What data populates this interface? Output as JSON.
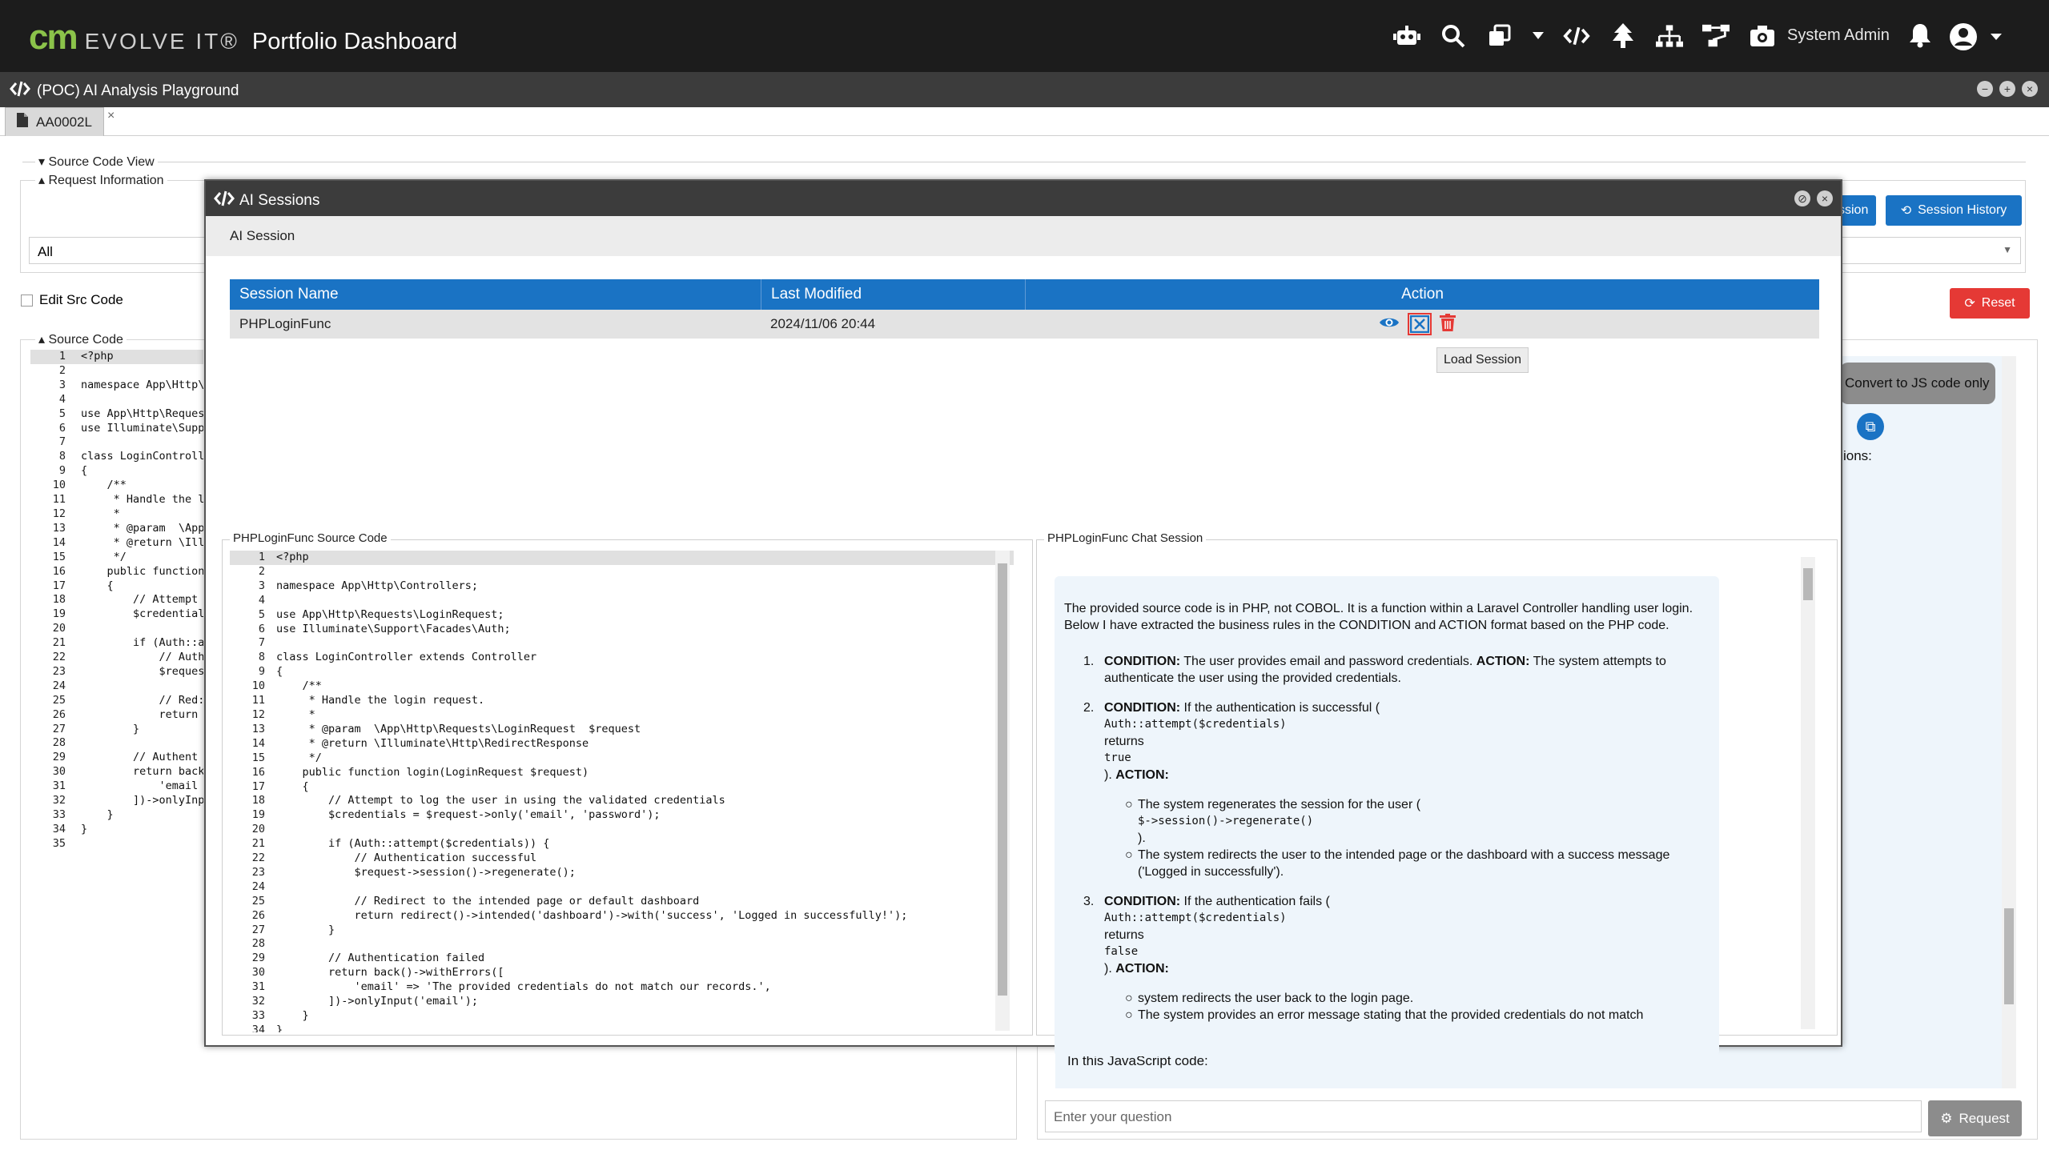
{
  "topbar": {
    "logo_cm": "CM",
    "logo_evolve": "EVOLVE IT®",
    "title": "Portfolio Dashboard",
    "user": "System Admin",
    "icons": [
      "robot-icon",
      "search-icon",
      "copy-icon",
      "caret-down-icon",
      "code-icon",
      "tree-icon",
      "hierarchy-icon",
      "flow-icon",
      "camera-icon",
      "bell-icon",
      "user-avatar-icon"
    ]
  },
  "window": {
    "title": "(POC) AI Analysis Playground"
  },
  "tabs": [
    {
      "label": "AA0002L"
    }
  ],
  "background": {
    "source_code_view": "Source Code View",
    "request_information": "Request Information",
    "filter_value": "All",
    "edit_src_code": "Edit Src Code",
    "source_code": "Source Code",
    "session_btn": "ssion",
    "session_history": "Session History",
    "reset": "Reset",
    "convert_btn": "Convert to JS code only",
    "options_text": "ions:",
    "js_text": "In this JavaScript code:",
    "question_placeholder": "Enter your question",
    "request_btn": "Request",
    "code_lines": [
      "<?php",
      "",
      "namespace App\\Http\\",
      "",
      "use App\\Http\\Reques",
      "use Illuminate\\Supp",
      "",
      "class LoginControll",
      "{",
      "    /**",
      "     * Handle the l",
      "     *",
      "     * @param  \\App",
      "     * @return \\Ill",
      "     */",
      "    public function",
      "    {",
      "        // Attempt",
      "        $credential",
      "",
      "        if (Auth::a",
      "            // Auth",
      "            $reques",
      "",
      "            // Red:",
      "            return",
      "        }",
      "",
      "        // Authent",
      "        return back",
      "            'email",
      "        ])->onlyInp",
      "    }",
      "}",
      ""
    ]
  },
  "modal": {
    "title": "AI Sessions",
    "subheader": "AI Session",
    "columns": [
      "Session Name",
      "Last Modified",
      "Action"
    ],
    "row": {
      "name": "PHPLoginFunc",
      "modified": "2024/11/06 20:44"
    },
    "tooltip": "Load Session",
    "source_panel_title": "PHPLoginFunc Source Code",
    "chat_panel_title": "PHPLoginFunc Chat Session",
    "source_lines": [
      "<?php",
      "",
      "namespace App\\Http\\Controllers;",
      "",
      "use App\\Http\\Requests\\LoginRequest;",
      "use Illuminate\\Support\\Facades\\Auth;",
      "",
      "class LoginController extends Controller",
      "{",
      "    /**",
      "     * Handle the login request.",
      "     *",
      "     * @param  \\App\\Http\\Requests\\LoginRequest  $request",
      "     * @return \\Illuminate\\Http\\RedirectResponse",
      "     */",
      "    public function login(LoginRequest $request)",
      "    {",
      "        // Attempt to log the user in using the validated credentials",
      "        $credentials = $request->only('email', 'password');",
      "",
      "        if (Auth::attempt($credentials)) {",
      "            // Authentication successful",
      "            $request->session()->regenerate();",
      "",
      "            // Redirect to the intended page or default dashboard",
      "            return redirect()->intended('dashboard')->with('success', 'Logged in successfully!');",
      "        }",
      "",
      "        // Authentication failed",
      "        return back()->withErrors([",
      "            'email' => 'The provided credentials do not match our records.',",
      "        ])->onlyInput('email');",
      "    }",
      "}"
    ],
    "chat": {
      "intro": "The provided source code is in PHP, not COBOL. It is a function within a Laravel Controller handling user login. Below I have extracted the business rules in the CONDITION and ACTION format based on the PHP code.",
      "r1_cond": "CONDITION:",
      "r1_cond_text": " The user provides email and password credentials. ",
      "r1_act": "ACTION:",
      "r1_act_text": " The system attempts to authenticate the user using the provided credentials.",
      "r2_cond": "CONDITION:",
      "r2_cond_text": " If the authentication is successful (",
      "r2_code": "Auth::attempt($credentials)",
      "r2_returns": "returns",
      "r2_val": "true",
      "r2_close": "). ",
      "r2_act": "ACTION:",
      "r2_b1": "The system regenerates the session for the user (",
      "r2_b1_code": "$->session()->regenerate()",
      "r2_b1_close": ").",
      "r2_b2": "The system redirects the user to the intended page or the dashboard with a success message ('Logged in successfully').",
      "r3_cond": "CONDITION:",
      "r3_cond_text": " If the authentication fails (",
      "r3_code": "Auth::attempt($credentials)",
      "r3_returns": "returns",
      "r3_val": "false",
      "r3_close": "). ",
      "r3_act": "ACTION:",
      "r3_b1": "system redirects the user back to the login page.",
      "r3_b2": "The system provides an error message stating that the provided credentials do not match"
    }
  },
  "colors": {
    "accent": "#1a73c4",
    "danger": "#e53935",
    "topbar": "#1c1c1c",
    "brand_green": "#8bc34a"
  }
}
